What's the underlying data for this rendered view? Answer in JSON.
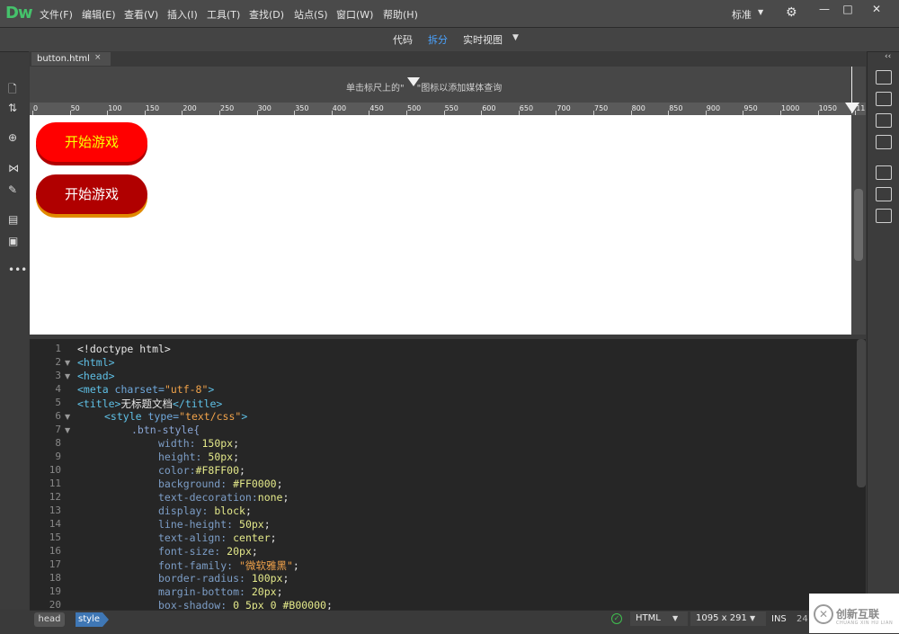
{
  "app": {
    "logo": "Dw",
    "menu": [
      "文件(F)",
      "编辑(E)",
      "查看(V)",
      "插入(I)",
      "工具(T)",
      "查找(D)",
      "站点(S)",
      "窗口(W)",
      "帮助(H)"
    ],
    "workspace": "标准",
    "window_buttons": {
      "minimize": "—",
      "maximize": "□",
      "close": "✕"
    }
  },
  "views": {
    "code": "代码",
    "split": "拆分",
    "live": "实时视图"
  },
  "document_tab": {
    "name": "button.html",
    "close": "×"
  },
  "media_query_hint": {
    "before": "单击标尺上的\"",
    "after": "\"图标以添加媒体查询"
  },
  "ruler_ticks": [
    "0",
    "50",
    "100",
    "150",
    "200",
    "250",
    "300",
    "350",
    "400",
    "450",
    "500",
    "550",
    "600",
    "650",
    "700",
    "750",
    "800",
    "850",
    "900",
    "950",
    "1000",
    "1050",
    "11"
  ],
  "live_view": {
    "buttons": [
      {
        "label": "开始游戏"
      },
      {
        "label": "开始游戏"
      }
    ]
  },
  "code_lines": [
    {
      "n": "1",
      "fold": "",
      "indent": 0,
      "parts": [
        [
          "c-plain",
          "<!doctype html>"
        ]
      ]
    },
    {
      "n": "2",
      "fold": "▼",
      "indent": 0,
      "parts": [
        [
          "c-tag",
          "<html>"
        ]
      ]
    },
    {
      "n": "3",
      "fold": "▼",
      "indent": 0,
      "parts": [
        [
          "c-tag",
          "<head>"
        ]
      ]
    },
    {
      "n": "4",
      "fold": "",
      "indent": 0,
      "parts": [
        [
          "c-tag",
          "<meta "
        ],
        [
          "c-attr",
          "charset="
        ],
        [
          "c-str",
          "\"utf-8\""
        ],
        [
          "c-tag",
          ">"
        ]
      ]
    },
    {
      "n": "5",
      "fold": "",
      "indent": 0,
      "parts": [
        [
          "c-tag",
          "<title>"
        ],
        [
          "c-plain",
          "无标题文档"
        ],
        [
          "c-tag",
          "</title>"
        ]
      ]
    },
    {
      "n": "6",
      "fold": "▼",
      "indent": 1,
      "parts": [
        [
          "c-tag",
          "<style "
        ],
        [
          "c-attr",
          "type="
        ],
        [
          "c-str",
          "\"text/css\""
        ],
        [
          "c-tag",
          ">"
        ]
      ]
    },
    {
      "n": "7",
      "fold": "▼",
      "indent": 2,
      "parts": [
        [
          "c-sel",
          ".btn-style{"
        ]
      ]
    },
    {
      "n": "8",
      "fold": "",
      "indent": 3,
      "parts": [
        [
          "c-prop",
          "width: "
        ],
        [
          "c-val",
          "150px"
        ],
        [
          "c-plain",
          ";"
        ]
      ]
    },
    {
      "n": "9",
      "fold": "",
      "indent": 3,
      "parts": [
        [
          "c-prop",
          "height: "
        ],
        [
          "c-val",
          "50px"
        ],
        [
          "c-plain",
          ";"
        ]
      ]
    },
    {
      "n": "10",
      "fold": "",
      "indent": 3,
      "parts": [
        [
          "c-prop",
          "color:"
        ],
        [
          "c-val",
          "#F8FF00"
        ],
        [
          "c-plain",
          ";"
        ]
      ]
    },
    {
      "n": "11",
      "fold": "",
      "indent": 3,
      "parts": [
        [
          "c-prop",
          "background: "
        ],
        [
          "c-val",
          "#FF0000"
        ],
        [
          "c-plain",
          ";"
        ]
      ]
    },
    {
      "n": "12",
      "fold": "",
      "indent": 3,
      "parts": [
        [
          "c-prop",
          "text-decoration:"
        ],
        [
          "c-val",
          "none"
        ],
        [
          "c-plain",
          ";"
        ]
      ]
    },
    {
      "n": "13",
      "fold": "",
      "indent": 3,
      "parts": [
        [
          "c-prop",
          "display: "
        ],
        [
          "c-val",
          "block"
        ],
        [
          "c-plain",
          ";"
        ]
      ]
    },
    {
      "n": "14",
      "fold": "",
      "indent": 3,
      "parts": [
        [
          "c-prop",
          "line-height: "
        ],
        [
          "c-val",
          "50px"
        ],
        [
          "c-plain",
          ";"
        ]
      ]
    },
    {
      "n": "15",
      "fold": "",
      "indent": 3,
      "parts": [
        [
          "c-prop",
          "text-align: "
        ],
        [
          "c-val",
          "center"
        ],
        [
          "c-plain",
          ";"
        ]
      ]
    },
    {
      "n": "16",
      "fold": "",
      "indent": 3,
      "parts": [
        [
          "c-prop",
          "font-size: "
        ],
        [
          "c-val",
          "20px"
        ],
        [
          "c-plain",
          ";"
        ]
      ]
    },
    {
      "n": "17",
      "fold": "",
      "indent": 3,
      "parts": [
        [
          "c-prop",
          "font-family: "
        ],
        [
          "c-str",
          "\"微软雅黑\""
        ],
        [
          "c-plain",
          ";"
        ]
      ]
    },
    {
      "n": "18",
      "fold": "",
      "indent": 3,
      "parts": [
        [
          "c-prop",
          "border-radius: "
        ],
        [
          "c-val",
          "100px"
        ],
        [
          "c-plain",
          ";"
        ]
      ]
    },
    {
      "n": "19",
      "fold": "",
      "indent": 3,
      "parts": [
        [
          "c-prop",
          "margin-bottom: "
        ],
        [
          "c-val",
          "20px"
        ],
        [
          "c-plain",
          ";"
        ]
      ]
    },
    {
      "n": "20",
      "fold": "",
      "indent": 3,
      "parts": [
        [
          "c-prop",
          "box-shadow: "
        ],
        [
          "c-val",
          "0 5px 0 #B00000"
        ],
        [
          "c-plain",
          ";"
        ]
      ]
    }
  ],
  "status": {
    "crumbs": {
      "head": "head",
      "style": "style"
    },
    "ok_icon": "✓",
    "language": "HTML",
    "size": "1095 x 291",
    "ins": "INS",
    "col": "24"
  },
  "watermark": {
    "text": "创新互联",
    "sub": "CHUANG XIN HU LIAN"
  },
  "colors": {
    "accent": "#4aa3ff",
    "btn_red": "#ff0000",
    "btn_dark": "#b00000",
    "btn_text_yellow": "#f8ff00"
  }
}
